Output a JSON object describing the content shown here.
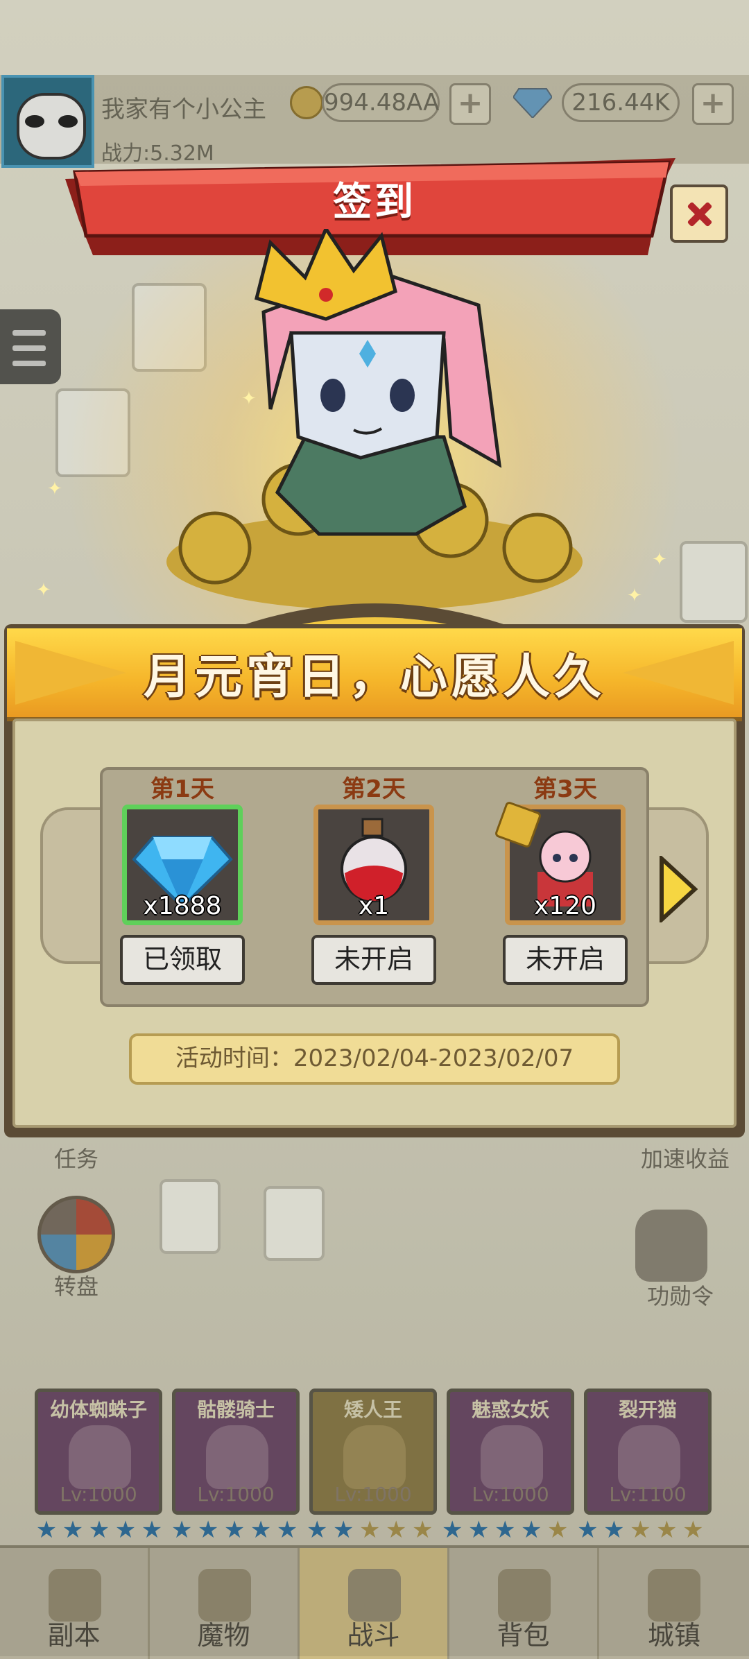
{
  "player": {
    "name": "我家有个小公主",
    "power": "战力:5.32M",
    "coins": "994.48AA",
    "gems": "216.44K",
    "plus": "+"
  },
  "scene": {
    "left_labels": [
      "任务",
      "转盘"
    ],
    "right_labels": [
      "加速收益",
      "功勋令"
    ]
  },
  "heroes": [
    {
      "name": "幼体蜘蛛子",
      "level": "Lv:1000"
    },
    {
      "name": "骷髅骑士",
      "level": "Lv:1000"
    },
    {
      "name": "矮人王",
      "level": "Lv:1000"
    },
    {
      "name": "魅惑女妖",
      "level": "Lv:1000"
    },
    {
      "name": "裂开猫",
      "level": "Lv:1100"
    }
  ],
  "nav": [
    "副本",
    "魔物",
    "战斗",
    "背包",
    "城镇"
  ],
  "dialog": {
    "title": "签到",
    "banner": "月元宵日，心愿人久",
    "days": [
      {
        "label": "第1天",
        "qty": "x1888",
        "status": "已领取",
        "item": "diamond-icon"
      },
      {
        "label": "第2天",
        "qty": "x1",
        "status": "未开启",
        "item": "potion-icon"
      },
      {
        "label": "第3天",
        "qty": "x120",
        "status": "未开启",
        "item": "hero-fragment-icon"
      }
    ],
    "activity_time": "活动时间：2023/02/04-2023/02/07"
  },
  "colors": {
    "title_red": "#e0453c",
    "banner_gold": "#f5b52a",
    "claimed_green": "#5fd05a",
    "locked_orange": "#c9944c"
  }
}
